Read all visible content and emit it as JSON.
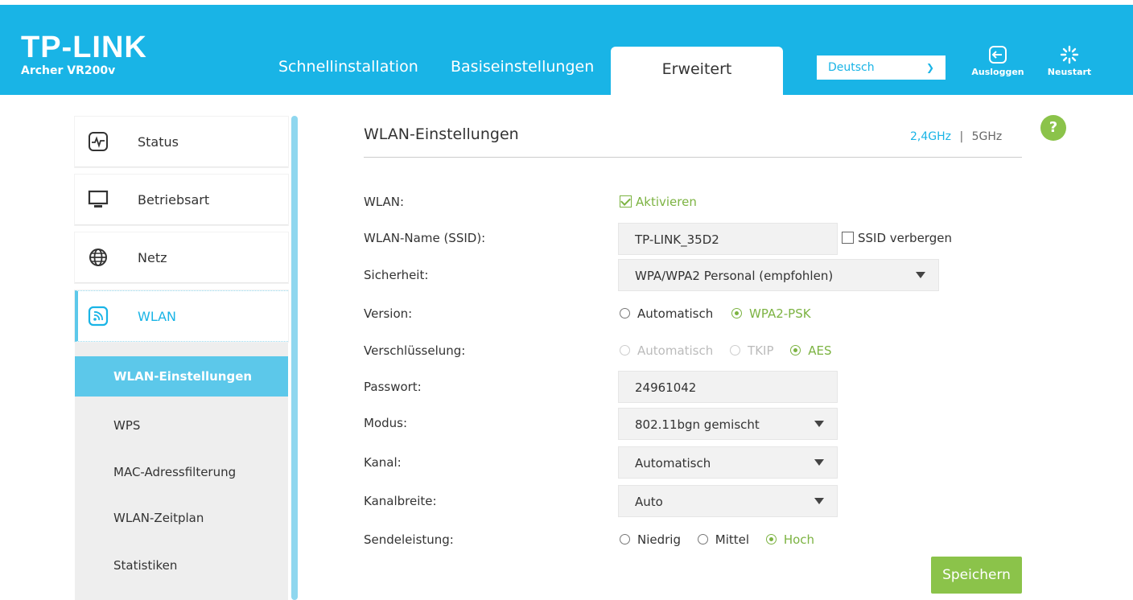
{
  "header": {
    "logo": "TP-LINK",
    "model": "Archer VR200v",
    "tabs": [
      {
        "label": "Schnellinstallation"
      },
      {
        "label": "Basiseinstellungen"
      },
      {
        "label": "Erweitert"
      }
    ],
    "language": "Deutsch",
    "logout_label": "Ausloggen",
    "reboot_label": "Neustart",
    "colors": {
      "brand": "#19b4e6"
    }
  },
  "sidebar": {
    "items": [
      {
        "label": "Status",
        "icon": "status-chart-icon"
      },
      {
        "label": "Betriebsart",
        "icon": "monitor-icon"
      },
      {
        "label": "Netz",
        "icon": "globe-icon"
      },
      {
        "label": "WLAN",
        "icon": "wifi-icon"
      }
    ],
    "sub_items": [
      {
        "label": "WLAN-Einstellungen"
      },
      {
        "label": "WPS"
      },
      {
        "label": "MAC-Adressfilterung"
      },
      {
        "label": "WLAN-Zeitplan"
      },
      {
        "label": "Statistiken"
      }
    ]
  },
  "main": {
    "title": "WLAN-Einstellungen",
    "band_24": "2,4GHz",
    "band_sep": "|",
    "band_5": "5GHz",
    "help": "?",
    "fields": {
      "wlan": {
        "label": "WLAN:",
        "option": "Aktivieren"
      },
      "ssid": {
        "label": "WLAN-Name (SSID):",
        "value": "TP-LINK_35D2",
        "hide_label": "SSID verbergen"
      },
      "security": {
        "label": "Sicherheit:",
        "value": "WPA/WPA2 Personal (empfohlen)"
      },
      "version": {
        "label": "Version:",
        "opt1": "Automatisch",
        "opt2": "WPA2-PSK"
      },
      "encryption": {
        "label": "Verschlüsselung:",
        "opt1": "Automatisch",
        "opt2": "TKIP",
        "opt3": "AES"
      },
      "password": {
        "label": "Passwort:",
        "value": "24961042"
      },
      "mode": {
        "label": "Modus:",
        "value": "802.11bgn gemischt"
      },
      "channel": {
        "label": "Kanal:",
        "value": "Automatisch"
      },
      "width": {
        "label": "Kanalbreite:",
        "value": "Auto"
      },
      "power": {
        "label": "Sendeleistung:",
        "opt1": "Niedrig",
        "opt2": "Mittel",
        "opt3": "Hoch"
      }
    },
    "save_label": "Speichern",
    "colors": {
      "accent": "#8bc34a"
    }
  }
}
